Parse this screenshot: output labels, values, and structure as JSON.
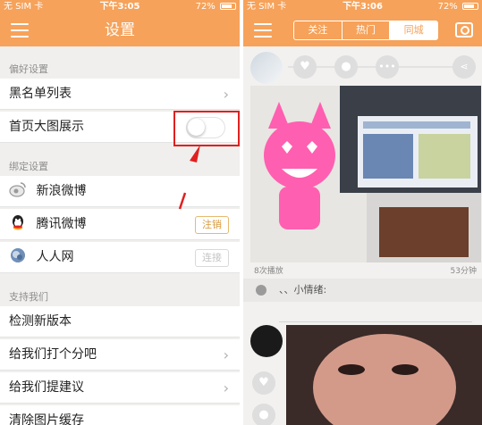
{
  "left": {
    "status": {
      "carrier": "无 SIM 卡",
      "time": "下午3:05",
      "battery": "72%"
    },
    "nav": {
      "title": "设置"
    },
    "sections": {
      "preferences": "偏好设置",
      "binding": "绑定设置",
      "support": "支持我们"
    },
    "rows": {
      "blacklist": "黑名单列表",
      "homepage_big": "首页大图展示",
      "weibo": "新浪微博",
      "tencent": "腾讯微博",
      "tencent_btn": "注销",
      "renren": "人人网",
      "renren_btn": "连接",
      "check_version": "检测新版本",
      "rate_us": "给我们打个分吧",
      "feedback": "给我们提建议",
      "clear_cache": "清除图片缓存"
    },
    "toggle_homepage_big": false
  },
  "right": {
    "status": {
      "carrier": "无 SIM 卡",
      "time": "下午3:06",
      "battery": "72%"
    },
    "tabs": [
      "关注",
      "热门",
      "同城"
    ],
    "selected_tab": "同城",
    "post": {
      "plays": "8次播放",
      "time": "53分钟",
      "caption": "、、小情绪:"
    }
  },
  "colors": {
    "brand": "#f6a25a",
    "highlight": "#e02020"
  }
}
